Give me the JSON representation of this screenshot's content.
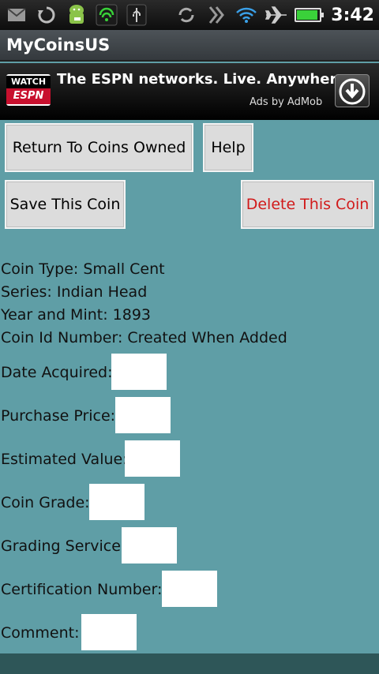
{
  "status_bar": {
    "time": "3:42",
    "battery_level": 0.92,
    "icons": [
      "mail-icon",
      "sync-icon",
      "android-icon",
      "wifi-hotspot-icon",
      "usb-icon",
      "sync-alt-icon",
      "vibrate-icon",
      "wifi-icon",
      "airplane-icon",
      "battery-icon"
    ]
  },
  "app": {
    "title": "MyCoinsUS"
  },
  "ad": {
    "logo_top": "WATCH",
    "logo_bottom": "ESPN",
    "headline": "The ESPN networks. Live. Anywhere",
    "attribution": "Ads by AdMob"
  },
  "buttons": {
    "return": "Return To Coins Owned",
    "help": "Help",
    "save": "Save This Coin",
    "delete": "Delete This Coin"
  },
  "coin": {
    "type": "Coin Type: Small Cent",
    "series": "Series: Indian Head",
    "year_mint": "Year and Mint: 1893",
    "id": "Coin Id Number: Created When Added"
  },
  "fields": {
    "date_acquired": "Date Acquired:",
    "purchase_price": "Purchase Price:",
    "estimated_value": "Estimated Value:",
    "coin_grade": "Coin Grade:",
    "grading_service": "Grading Service:",
    "certification_number": "Certification Number:",
    "comment": "Comment:"
  },
  "colors": {
    "background": "#5f9ea6",
    "delete_text": "#d11a1a"
  }
}
